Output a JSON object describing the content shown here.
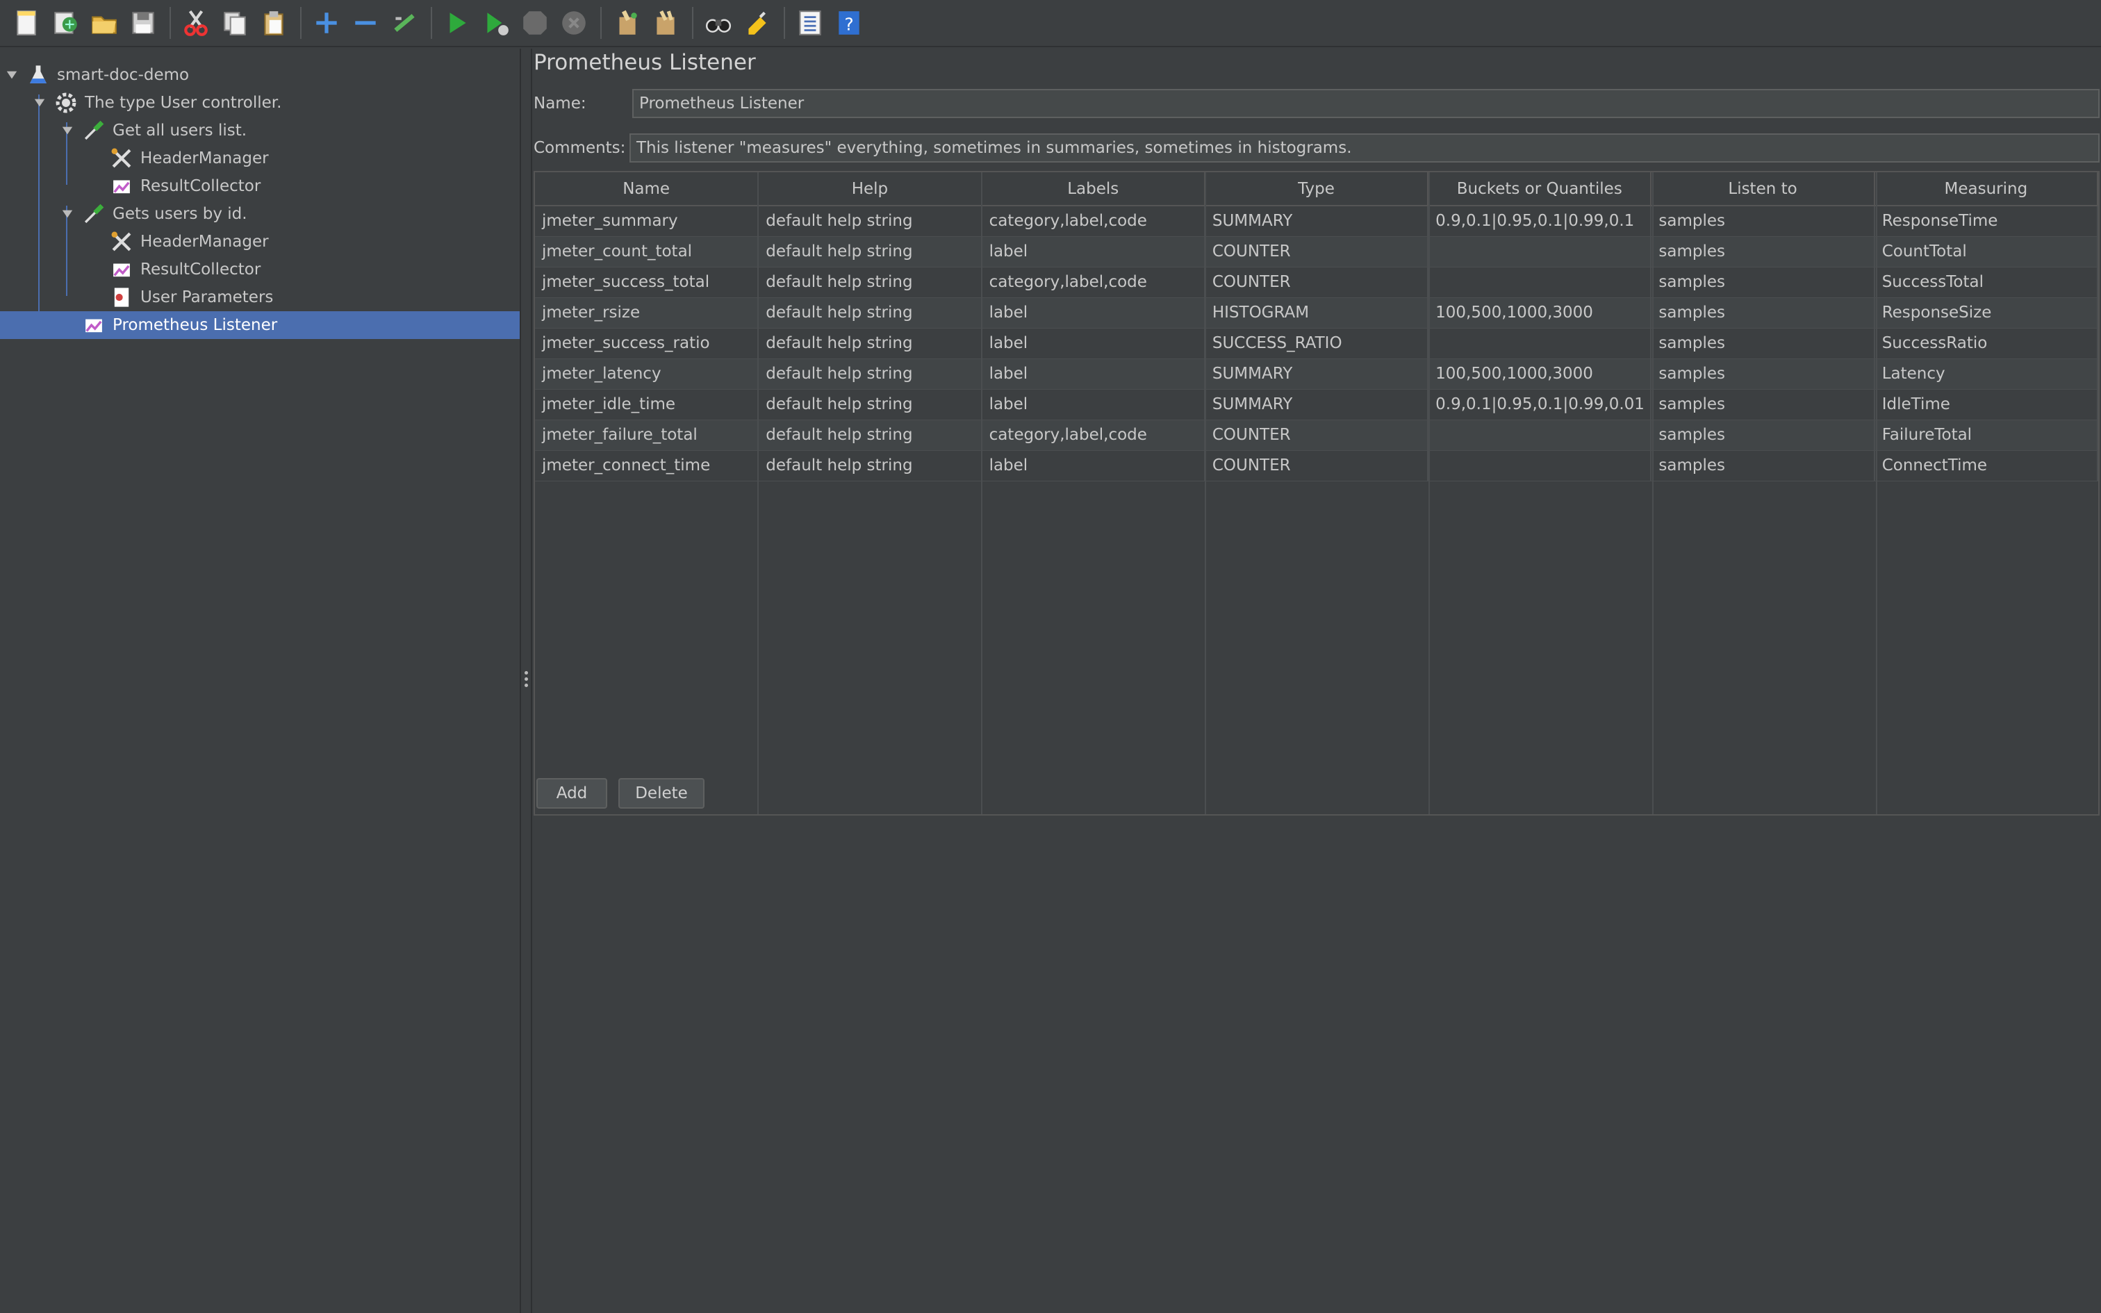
{
  "toolbar": {
    "buttons": [
      "new-icon",
      "templates-icon",
      "open-icon",
      "save-icon",
      "cut-icon",
      "copy-icon",
      "paste-icon",
      "expand-icon",
      "collapse-icon",
      "toggle-icon",
      "start-icon",
      "start-no-pause-icon",
      "stop-icon",
      "shutdown-icon",
      "clear-icon",
      "clear-all-icon",
      "search-icon",
      "reset-search-icon",
      "function-helper-icon",
      "help-icon"
    ]
  },
  "tree": {
    "root": "smart-doc-demo",
    "controller": "The type User controller.",
    "sampler1": "Get all users list.",
    "header1": "HeaderManager",
    "collector1": "ResultCollector",
    "sampler2": "Gets users by id.",
    "header2": "HeaderManager",
    "collector2": "ResultCollector",
    "params": "User Parameters",
    "listener": "Prometheus Listener"
  },
  "panel": {
    "title": "Prometheus Listener",
    "name_label": "Name:",
    "name_value": "Prometheus Listener",
    "comments_label": "Comments:",
    "comments_value": "This listener \"measures\" everything, sometimes in summaries, sometimes in histograms."
  },
  "table": {
    "headers": [
      "Name",
      "Help",
      "Labels",
      "Type",
      "Buckets or Quantiles",
      "Listen to",
      "Measuring"
    ],
    "rows": [
      [
        "jmeter_summary",
        "default help string",
        "category,label,code",
        "SUMMARY",
        "0.9,0.1|0.95,0.1|0.99,0.1",
        "samples",
        "ResponseTime"
      ],
      [
        "jmeter_count_total",
        "default help string",
        "label",
        "COUNTER",
        "",
        "samples",
        "CountTotal"
      ],
      [
        "jmeter_success_total",
        "default help string",
        "category,label,code",
        "COUNTER",
        "",
        "samples",
        "SuccessTotal"
      ],
      [
        "jmeter_rsize",
        "default help string",
        "label",
        "HISTOGRAM",
        "100,500,1000,3000",
        "samples",
        "ResponseSize"
      ],
      [
        "jmeter_success_ratio",
        "default help string",
        "label",
        "SUCCESS_RATIO",
        "",
        "samples",
        "SuccessRatio"
      ],
      [
        "jmeter_latency",
        "default help string",
        "label",
        "SUMMARY",
        "100,500,1000,3000",
        "samples",
        "Latency"
      ],
      [
        "jmeter_idle_time",
        "default help string",
        "label",
        "SUMMARY",
        "0.9,0.1|0.95,0.1|0.99,0.01",
        "samples",
        "IdleTime"
      ],
      [
        "jmeter_failure_total",
        "default help string",
        "category,label,code",
        "COUNTER",
        "",
        "samples",
        "FailureTotal"
      ],
      [
        "jmeter_connect_time",
        "default help string",
        "label",
        "COUNTER",
        "",
        "samples",
        "ConnectTime"
      ]
    ]
  },
  "buttons": {
    "add": "Add",
    "delete": "Delete"
  }
}
